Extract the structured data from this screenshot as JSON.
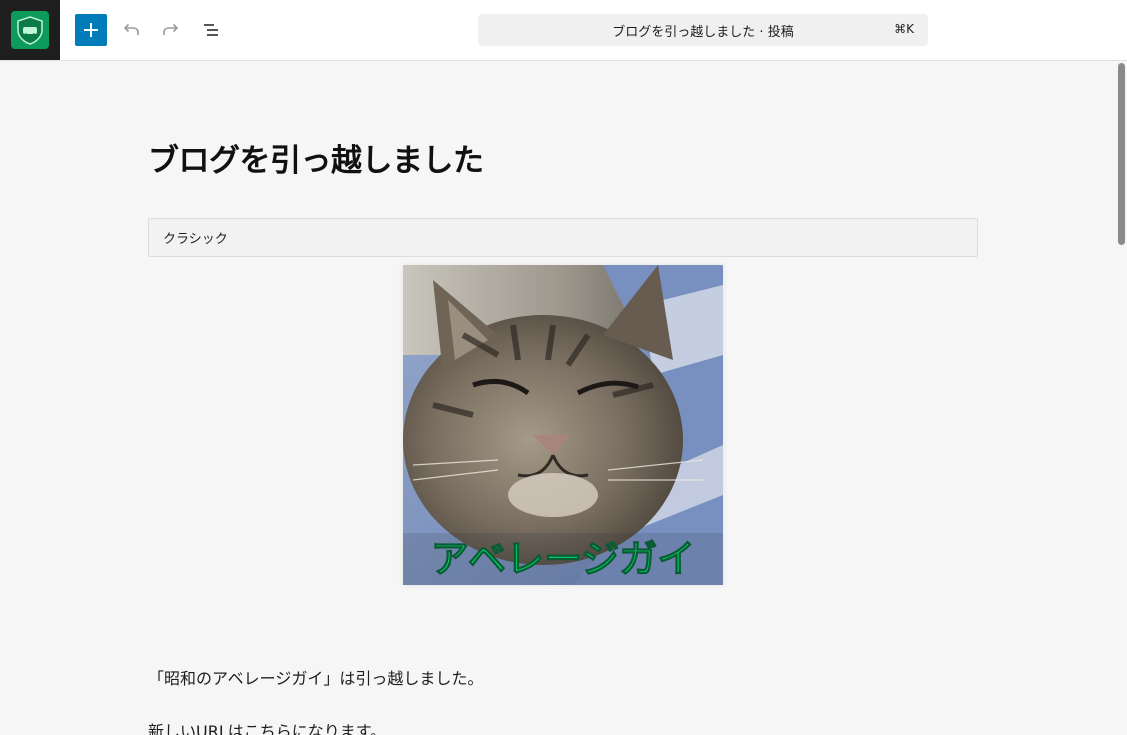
{
  "toolbar": {
    "add_block_label": "+",
    "command_bar_title": "ブログを引っ越しました · 投稿",
    "command_bar_shortcut": "⌘K"
  },
  "post": {
    "title": "ブログを引っ越しました",
    "classic_block_label": "クラシック",
    "image_overlay_text": "アベレージガイ",
    "paragraphs": [
      "「昭和のアベレージガイ」は引っ越しました。",
      "新しいURLはこちらになります。"
    ]
  },
  "colors": {
    "accent": "#007cba",
    "brand_green": "#0c9b5b",
    "image_text_green": "#00d06a"
  },
  "icons": {
    "site": "site-logo-icon",
    "undo": "undo-icon",
    "redo": "redo-icon",
    "list_view": "list-view-icon"
  }
}
